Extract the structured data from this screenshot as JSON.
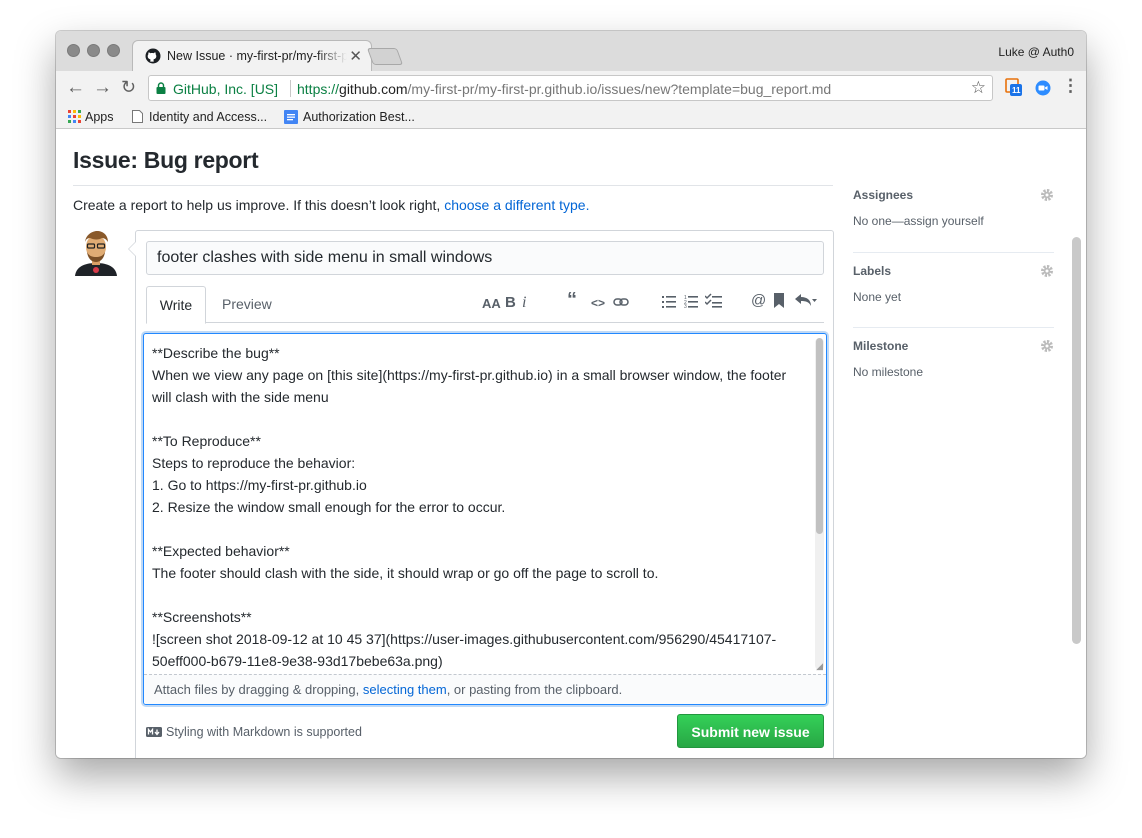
{
  "browser": {
    "tab_title": "New Issue · my-first-pr/my-first-pr.github.io",
    "profile": "Luke @ Auth0",
    "security_label": "GitHub, Inc. [US]",
    "url_scheme": "https://",
    "url_host": "github.com",
    "url_path": "/my-first-pr/my-first-pr.github.io/issues/new?template=bug_report.md",
    "extension_badge": "11",
    "bookmarks": [
      "Apps",
      "Identity and Access...",
      "Authorization Best..."
    ]
  },
  "page": {
    "heading": "Issue: Bug report",
    "intro_text": "Create a report to help us improve. If this doesn’t look right, ",
    "intro_link": "choose a different type.",
    "title_value": "footer clashes with side menu in small windows",
    "tabs": [
      "Write",
      "Preview"
    ],
    "body_value": "**Describe the bug**\nWhen we view any page on [this site](https://my-first-pr.github.io) in a small browser window, the footer will clash with the side menu\n\n**To Reproduce**\nSteps to reproduce the behavior:\n1. Go to https://my-first-pr.github.io\n2. Resize the window small enough for the error to occur.\n\n**Expected behavior**\nThe footer should clash with the side, it should wrap or go off the page to scroll to.\n\n**Screenshots**\n![screen shot 2018-09-12 at 10 45 37](https://user-images.githubusercontent.com/956290/45417107-50eff000-b679-11e8-9e38-93d17bebe63a.png)",
    "attach_text_1": "Attach files by dragging & dropping, ",
    "attach_link": "selecting them",
    "attach_text_2": ", or pasting from the clipboard.",
    "markdown_note": "Styling with Markdown is supported",
    "submit_label": "Submit new issue"
  },
  "sidebar": {
    "assignees_label": "Assignees",
    "assignees_value": "No one—assign yourself",
    "labels_label": "Labels",
    "labels_value": "None yet",
    "milestone_label": "Milestone",
    "milestone_value": "No milestone"
  },
  "colors": {
    "link": "#0366d6",
    "submit_green": "#28a745",
    "secure_green": "#0b8043",
    "focus_blue": "#2188ff"
  }
}
